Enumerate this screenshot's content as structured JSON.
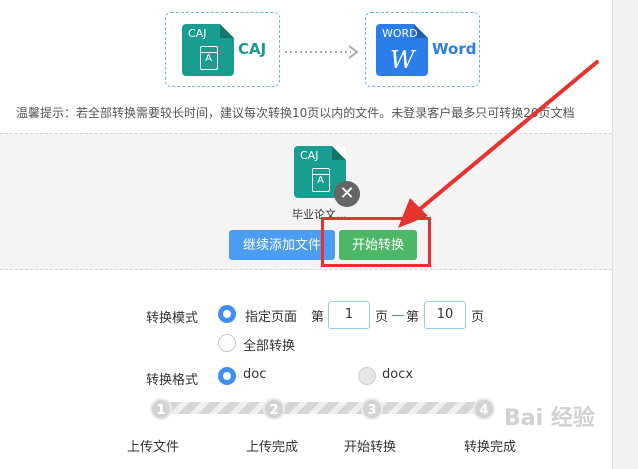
{
  "converter": {
    "source_icon_label": "CAJ",
    "source_format": "CAJ",
    "target_icon_label": "WORD",
    "target_format": "Word",
    "target_glyph": "W",
    "book_glyph": "A"
  },
  "tip": "温馨提示：若全部转换需要较长时间，建议每次转换10页以内的文件。未登录客户最多只可转换20页文档",
  "upload": {
    "file_icon_label": "CAJ",
    "file_name": "毕业论文...",
    "remove_glyph": "✕",
    "add_button": "继续添加文件",
    "start_button": "开始转换"
  },
  "mode": {
    "label": "转换模式",
    "option_specified": "指定页面",
    "page_prefix": "第",
    "from_page": "1",
    "page_suffix_from": "页",
    "to_prefix": "第",
    "to_page": "10",
    "page_suffix_to": "页",
    "option_all": "全部转换"
  },
  "format": {
    "label": "转换格式",
    "option_doc": "doc",
    "option_docx": "docx"
  },
  "steps": [
    {
      "num": "1",
      "label": "上传文件"
    },
    {
      "num": "2",
      "label": "上传完成"
    },
    {
      "num": "3",
      "label": "开始转换"
    },
    {
      "num": "4",
      "label": "转换完成"
    }
  ],
  "watermark": "Bai 经验",
  "colors": {
    "caj_teal": "#1a9d91",
    "word_blue": "#2b7de9",
    "add_button_blue": "#4a9df0",
    "start_button_green": "#4cb867",
    "annotation_red": "#e8322d"
  }
}
